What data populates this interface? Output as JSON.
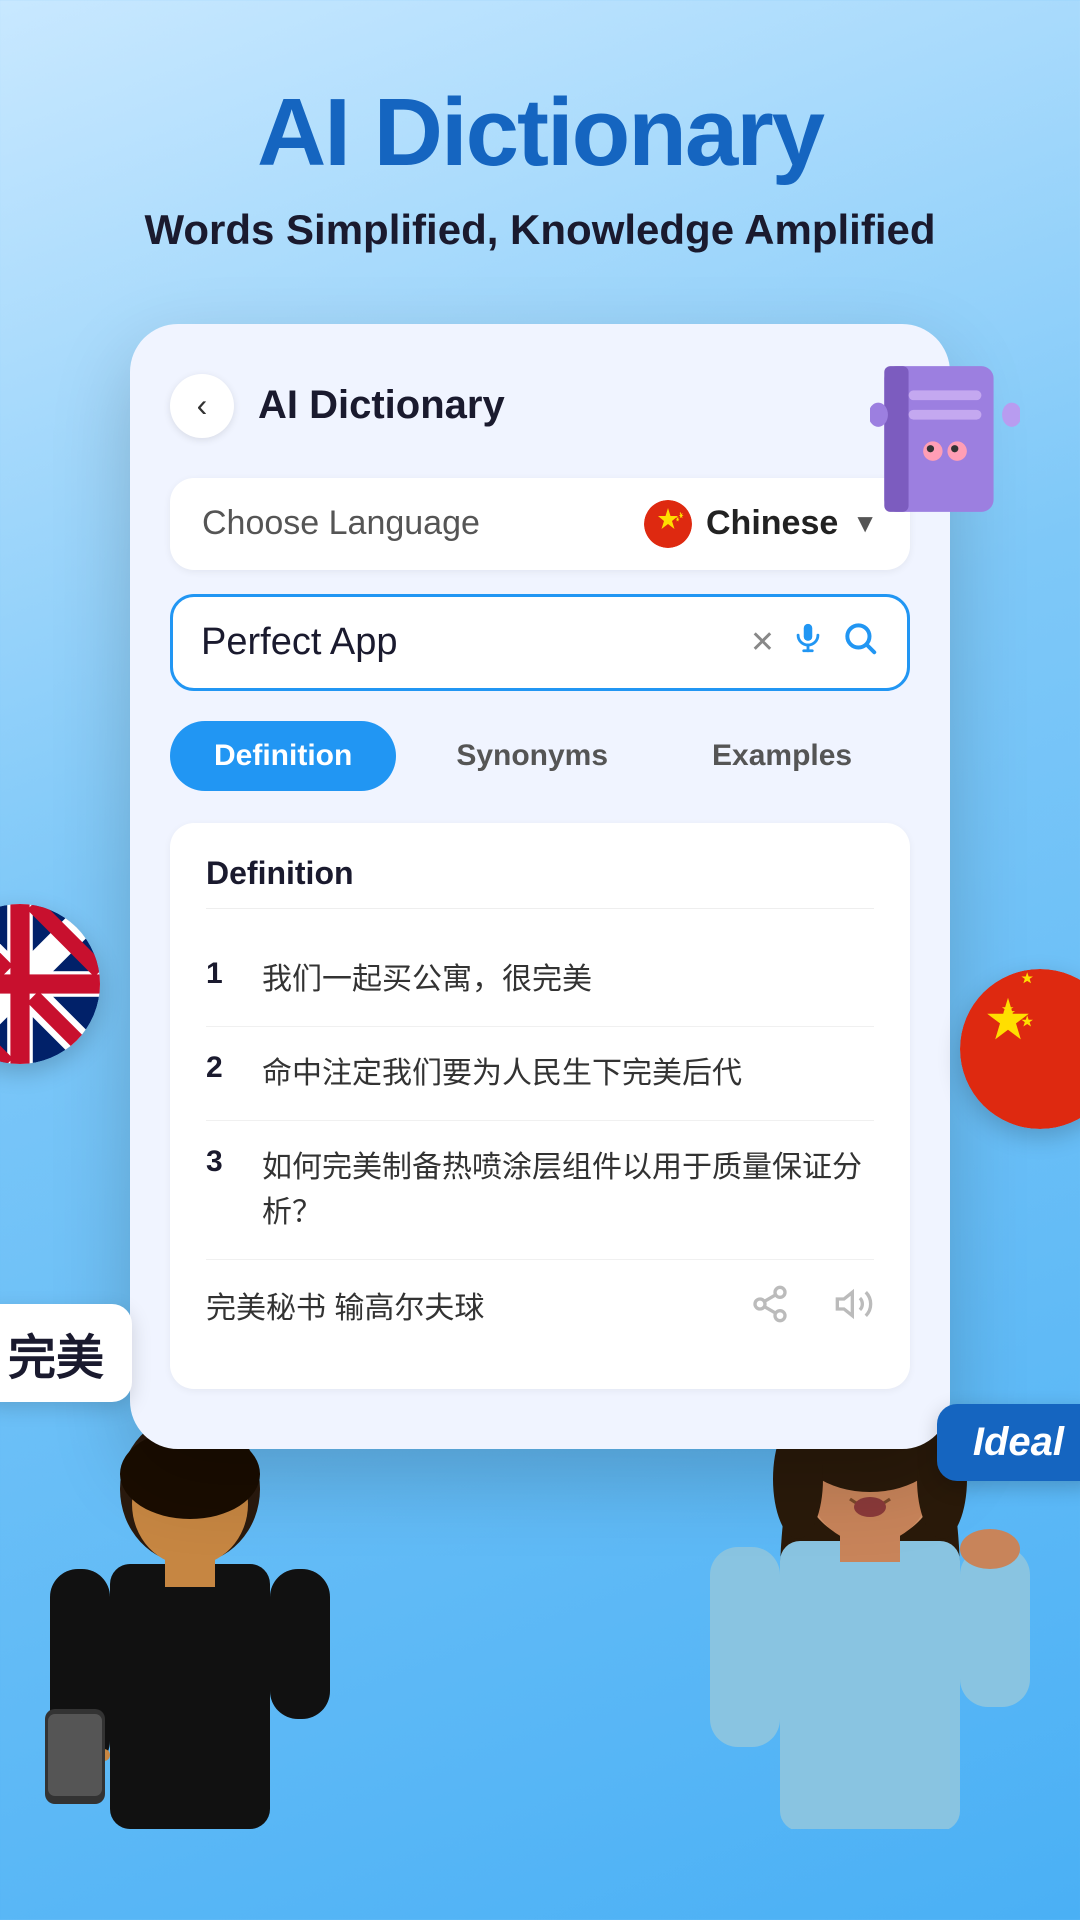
{
  "hero": {
    "title": "AI Dictionary",
    "subtitle": "Words Simplified, Knowledge Amplified"
  },
  "card": {
    "back_label": "‹",
    "title": "AI Dictionary",
    "language_label": "Choose Language",
    "language_selected": "Chinese",
    "search_value": "Perfect App",
    "tabs": [
      {
        "label": "Definition",
        "active": true
      },
      {
        "label": "Synonyms",
        "active": false
      },
      {
        "label": "Examples",
        "active": false
      }
    ],
    "section_heading": "Definition",
    "definitions": [
      {
        "number": "1",
        "text": "我们一起买公寓，很完美"
      },
      {
        "number": "2",
        "text": "命中注定我们要为人民生下完美后代"
      },
      {
        "number": "3",
        "text": "如何完美制备热喷涂层组件以用于质量保证分析？"
      },
      {
        "number": "",
        "text": "完美秘书                输高尔夫球"
      }
    ]
  },
  "floating": {
    "kanji": "完美",
    "ideal": "Ideal"
  },
  "icons": {
    "back": "‹",
    "clear": "✕",
    "mic": "🎤",
    "search": "🔍",
    "chevron": "▼",
    "share": "⎙"
  }
}
